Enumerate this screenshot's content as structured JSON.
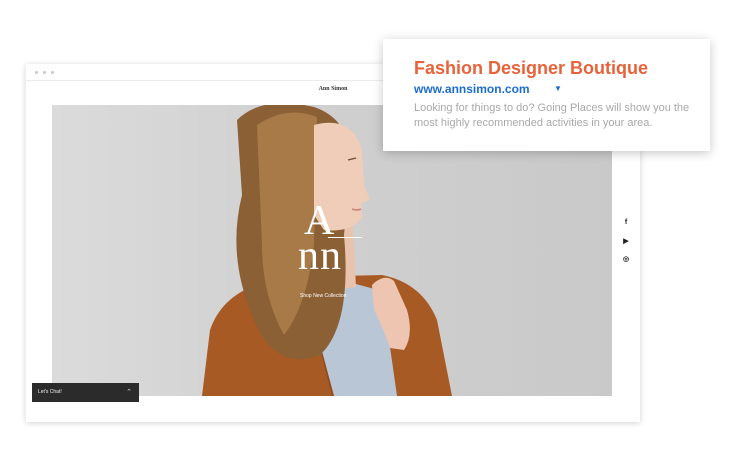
{
  "site": {
    "title": "Ann Simon",
    "logo_top": "A",
    "logo_bottom": "nn",
    "shop_link": "Shop New Collection"
  },
  "social": [
    {
      "name": "facebook-icon",
      "glyph": "f"
    },
    {
      "name": "youtube-icon",
      "glyph": "▶"
    },
    {
      "name": "instagram-icon",
      "glyph": "◎"
    }
  ],
  "chat": {
    "label": "Let's Chat!",
    "caret": "⌃"
  },
  "ad": {
    "title": "Fashion Designer Boutique",
    "url": "www.annsimon.com",
    "dropdown": "▼",
    "description": "Looking for things to do? Going Places will show you the most highly recommended activities in your area."
  },
  "colors": {
    "ad_title": "#e8623a",
    "ad_url": "#1c6dd0",
    "jacket": "#a85a24"
  }
}
